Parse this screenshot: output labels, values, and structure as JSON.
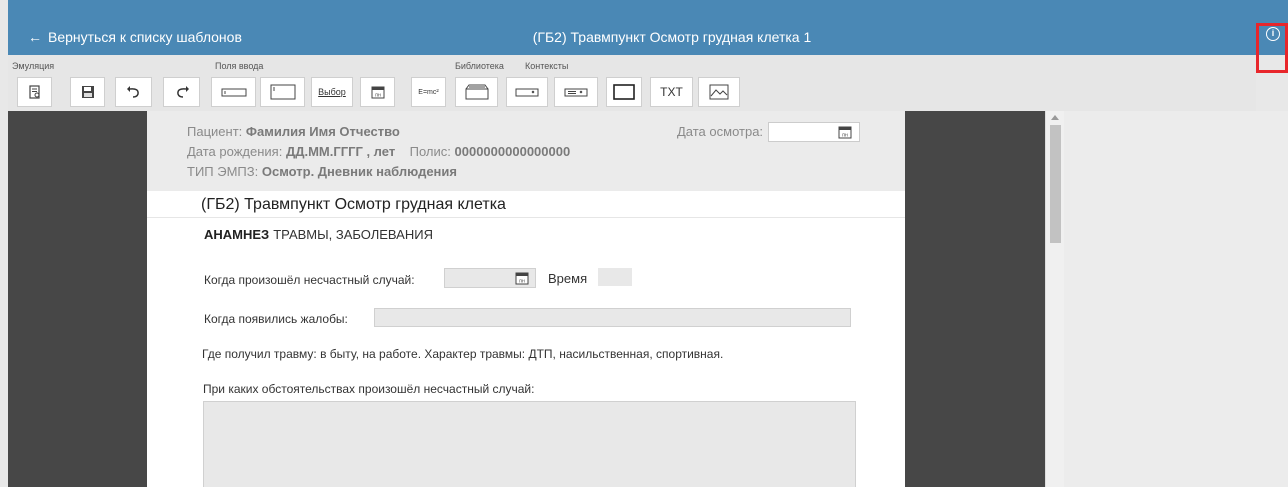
{
  "header": {
    "back_label": "Вернуться к списку шаблонов",
    "title": "(ГБ2) Травмпункт Осмотр грудная клетка 1",
    "info_icon": "info-icon",
    "color": "#4a88b5"
  },
  "toolbar": {
    "groups": {
      "emulation": "Эмуляция",
      "input_fields": "Поля ввода",
      "library": "Библиотека",
      "contexts": "Контексты"
    },
    "choice_label": "Выбор",
    "formula_label": "E=mc²",
    "txt_label": "TXT"
  },
  "doc_header": {
    "patient_label": "Пациент:",
    "patient_value": "Фамилия Имя Отчество",
    "dob_label": "Дата рождения:",
    "dob_value": "ДД.ММ.ГГГГ , лет",
    "policy_label": "Полис:",
    "policy_value": "0000000000000000",
    "type_label": "ТИП ЭМПЗ:",
    "type_value": "Осмотр. Дневник наблюдения",
    "exam_date_label": "Дата осмотра:"
  },
  "document": {
    "title": "(ГБ2) Травмпункт Осмотр грудная клетка",
    "section_bold": "АНАМНЕЗ",
    "section_rest": "ТРАВМЫ, ЗАБОЛЕВАНИЯ",
    "accident_label": "Когда произошёл несчастный случай:",
    "time_label": "Время",
    "complaints_label": "Когда появились жалобы:",
    "injury_place_label": "Где получил травму:",
    "injury_place_1": "в быту,",
    "injury_place_2": "на работе.",
    "injury_type_label": "Характер травмы:",
    "injury_type_1": "ДТП,",
    "injury_type_2": "насильственная,",
    "injury_type_3": "спортивная.",
    "circumstances_label": "При каких обстоятельствах произошёл несчастный случай:"
  }
}
